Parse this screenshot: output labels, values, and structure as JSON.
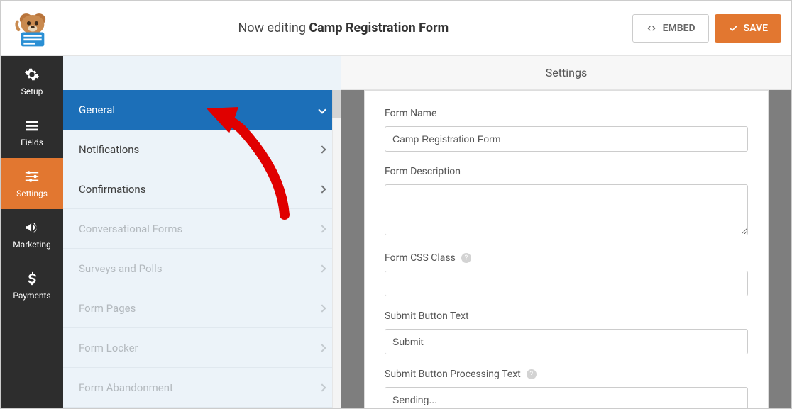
{
  "top": {
    "editing_prefix": "Now editing ",
    "form_title": "Camp Registration Form",
    "embed": "EMBED",
    "save": "SAVE"
  },
  "nav": {
    "setup": "Setup",
    "fields": "Fields",
    "settings": "Settings",
    "marketing": "Marketing",
    "payments": "Payments"
  },
  "side": {
    "general": "General",
    "notifications": "Notifications",
    "confirmations": "Confirmations",
    "conversational": "Conversational Forms",
    "surveys": "Surveys and Polls",
    "form_pages": "Form Pages",
    "form_locker": "Form Locker",
    "form_abandonment": "Form Abandonment"
  },
  "content": {
    "heading": "Settings",
    "form_name_label": "Form Name",
    "form_name_value": "Camp Registration Form",
    "form_desc_label": "Form Description",
    "form_desc_value": "",
    "form_css_label": "Form CSS Class",
    "form_css_value": "",
    "submit_text_label": "Submit Button Text",
    "submit_text_value": "Submit",
    "submit_proc_label": "Submit Button Processing Text",
    "submit_proc_value": "Sending..."
  }
}
